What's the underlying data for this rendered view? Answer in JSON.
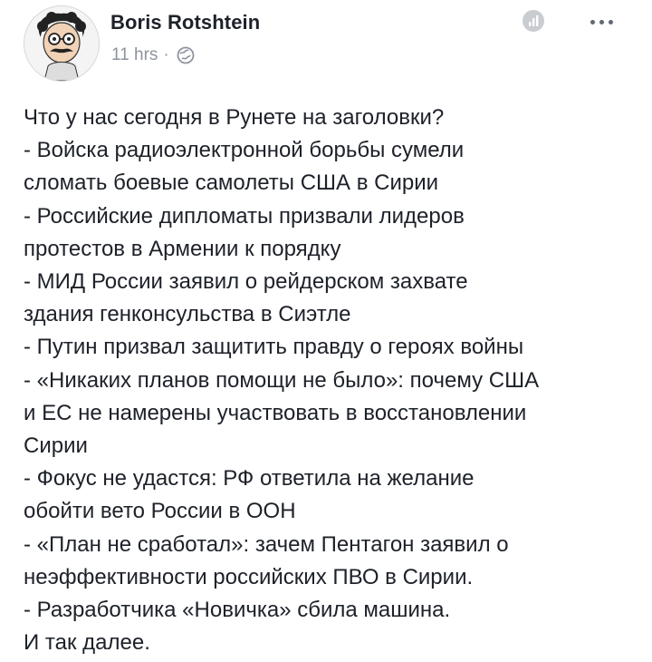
{
  "post": {
    "author": "Boris Rotshtein",
    "time": "11 hrs",
    "separator": "·",
    "lines": [
      "Что у нас сегодня в Рунете на заголовки?",
      "- Войска радиоэлектронной борьбы сумели",
      "сломать боевые самолеты США в Сирии",
      "- Российские дипломаты призвали лидеров",
      "протестов в Армении к порядку",
      "- МИД России заявил о рейдерском захвате",
      "здания генконсульства в Сиэтле",
      "- Путин призвал защитить правду о героях войны",
      "- «Никаких планов помощи не было»: почему США",
      "и ЕС не намерены участвовать в восстановлении",
      "Сирии",
      "- Фокус не удастся: РФ ответила на желание",
      "обойти вето России в ООН",
      "- «План не сработал»: зачем Пентагон заявил о",
      "неэффективности российских ПВО в Сирии.",
      "- Разработчика «Новичка» сбила машина.",
      "И так далее."
    ]
  },
  "icons": {
    "privacy": "globe-icon",
    "stats": "bar-chart-icon",
    "menu": "more-options-icon"
  },
  "colors": {
    "text": "#1d2129",
    "meta": "#8d949e"
  }
}
